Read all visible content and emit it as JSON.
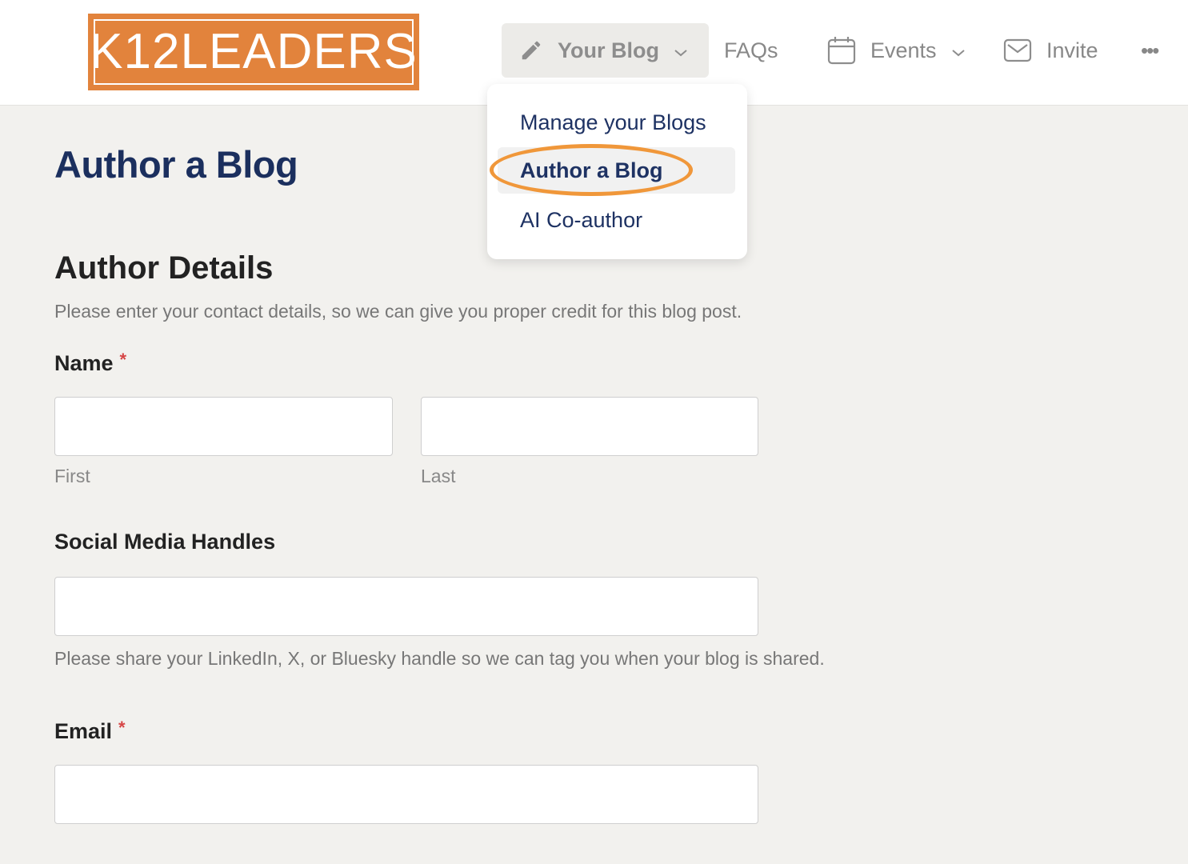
{
  "logo": {
    "text": "K12LEADERS"
  },
  "nav": {
    "your_blog": "Your Blog",
    "faqs": "FAQs",
    "events": "Events",
    "invite": "Invite",
    "more": "•••"
  },
  "dropdown": {
    "items": [
      "Manage your Blogs",
      "Author a Blog",
      "AI Co-author"
    ]
  },
  "page": {
    "title": "Author a Blog"
  },
  "author_details": {
    "heading": "Author Details",
    "description": "Please enter your contact details, so we can give you proper credit for this blog post."
  },
  "form": {
    "name_label": "Name",
    "required_mark": "*",
    "first_value": "",
    "first_sublabel": "First",
    "last_value": "",
    "last_sublabel": "Last",
    "social_label": "Social Media Handles",
    "social_value": "",
    "social_help": "Please share your LinkedIn, X, or Bluesky handle so we can tag you when your blog is shared.",
    "email_label": "Email",
    "email_value": ""
  },
  "colors": {
    "brand_orange": "#e2833c",
    "highlight_ring": "#f0973a",
    "title_navy": "#1b2f5e",
    "required_red": "#d64545",
    "page_bg": "#f2f1ee"
  }
}
